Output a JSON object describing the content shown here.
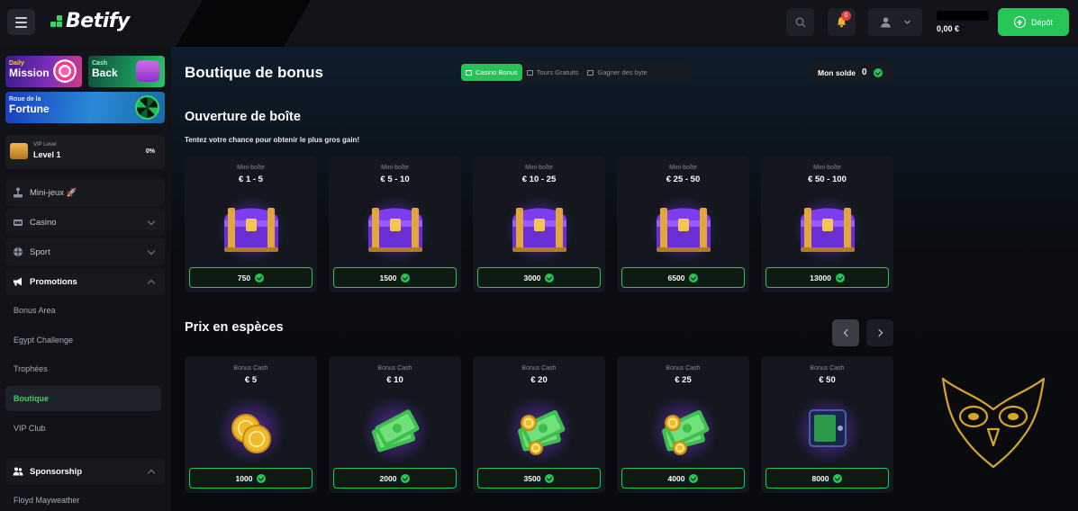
{
  "header": {
    "logo_text": "Betify",
    "balance": "0,00 €",
    "notification_count": "0",
    "deposit_label": "Dépôt"
  },
  "sidebar": {
    "promos": [
      {
        "small": "Daily",
        "big": "Mission"
      },
      {
        "small": "Cash",
        "big": "Back"
      },
      {
        "small": "Roue de la",
        "big": "Fortune"
      }
    ],
    "vip": {
      "label": "VIP Level",
      "level": "Level 1",
      "progress": "0%"
    },
    "items": [
      {
        "label": "Mini-jeux 🚀",
        "icon": "joystick-icon"
      },
      {
        "label": "Casino",
        "icon": "casino-icon"
      },
      {
        "label": "Sport",
        "icon": "ball-icon"
      },
      {
        "label": "Promotions",
        "icon": "megaphone-icon"
      }
    ],
    "promotions_sub": [
      "Bonus Area",
      "Egypt Challenge",
      "Trophées",
      "Boutique",
      "VIP Club"
    ],
    "sponsorship": {
      "label": "Sponsorship",
      "sub": [
        "Floyd Mayweather"
      ]
    }
  },
  "main": {
    "title": "Boutique de bonus",
    "tabs": [
      {
        "label": "Casino Bonus",
        "active": true
      },
      {
        "label": "Tours Gratuits",
        "active": false
      },
      {
        "label": "Gagner des byte",
        "active": false
      }
    ],
    "solde_label": "Mon solde",
    "solde_value": "0",
    "box_section": {
      "title": "Ouverture de boîte",
      "subtitle": "Tentez votre chance pour obtenir le plus gros gain!",
      "cards": [
        {
          "category": "Mini-boîte",
          "range": "€ 1 - 5",
          "price": "750"
        },
        {
          "category": "Mini-boîte",
          "range": "€ 5 - 10",
          "price": "1500"
        },
        {
          "category": "Mini-boîte",
          "range": "€ 10 - 25",
          "price": "3000"
        },
        {
          "category": "Mini-boîte",
          "range": "€ 25 - 50",
          "price": "6500"
        },
        {
          "category": "Mini-boîte",
          "range": "€ 50 - 100",
          "price": "13000"
        }
      ]
    },
    "cash_section": {
      "title": "Prix en espèces",
      "cards": [
        {
          "category": "Bonus Cash",
          "amount": "€ 5",
          "price": "1000",
          "art": "coins"
        },
        {
          "category": "Bonus Cash",
          "amount": "€ 10",
          "price": "2000",
          "art": "cash"
        },
        {
          "category": "Bonus Cash",
          "amount": "€ 20",
          "price": "3500",
          "art": "cash-coins"
        },
        {
          "category": "Bonus Cash",
          "amount": "€ 25",
          "price": "4000",
          "art": "cash-coins"
        },
        {
          "category": "Bonus Cash",
          "amount": "€ 50",
          "price": "8000",
          "art": "safe"
        }
      ]
    }
  },
  "colors": {
    "accent": "#27c458",
    "background": "#0c0e13",
    "panel": "#141720"
  }
}
